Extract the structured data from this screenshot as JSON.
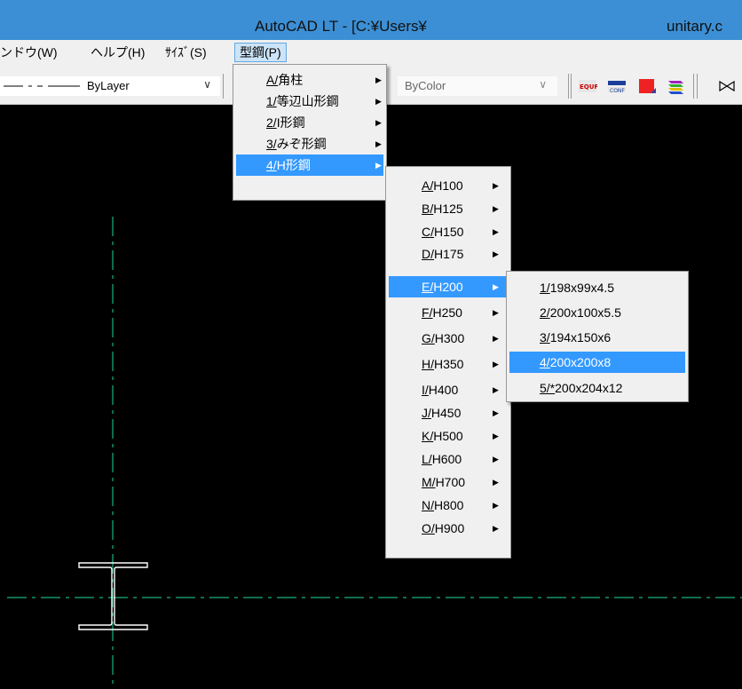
{
  "titlebar": {
    "title": "AutoCAD LT - [C:¥Users¥",
    "title_right": "unitary.c"
  },
  "menubar": {
    "items": [
      "ンドウ(W)",
      "ヘルプ(H)",
      "ｻｲｽﾞ(S)",
      "型鋼(P)"
    ]
  },
  "toolbar": {
    "linetype": "ByLayer",
    "color": "ByColor",
    "icons": [
      "equp-icon",
      "conf-icon",
      "red-square-icon",
      "layers-icon"
    ]
  },
  "menu_katakou": {
    "items": [
      "A/角柱",
      "1/等辺山形鋼",
      "2/I形鋼",
      "3/みぞ形鋼",
      "4/H形鋼"
    ],
    "selected_index": 4
  },
  "menu_h": {
    "items": [
      "A/H100",
      "B/H125",
      "C/H150",
      "D/H175",
      "E/H200",
      "F/H250",
      "G/H300",
      "H/H350",
      "I/H400",
      "J/H450",
      "K/H500",
      "L/H600",
      "M/H700",
      "N/H800",
      "O/H900"
    ],
    "selected_index": 4
  },
  "menu_h200": {
    "items": [
      "1/198x99x4.5",
      "2/200x100x5.5",
      "3/194x150x6",
      "4/200x200x8",
      "5/*200x204x12"
    ],
    "selected_index": 3
  },
  "colors": {
    "title_bg": "#3c8fd4",
    "menu_select": "#3399ff",
    "centerline": "#19b37a"
  }
}
